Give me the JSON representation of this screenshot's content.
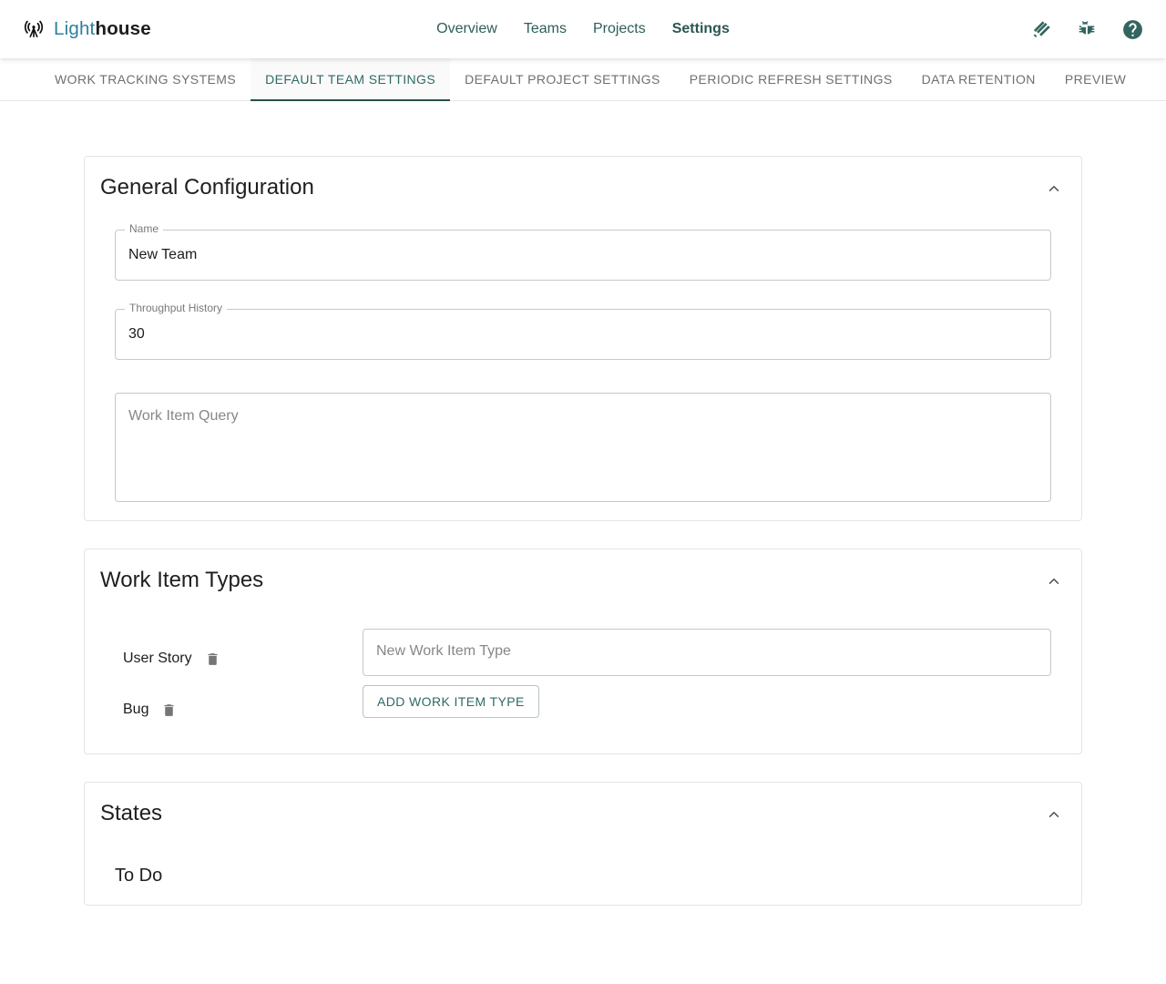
{
  "brand": {
    "name_light": "Light",
    "name_bold": "house",
    "icon": "broadcast-tower-icon"
  },
  "header": {
    "nav": [
      {
        "label": "Overview",
        "active": false
      },
      {
        "label": "Teams",
        "active": false
      },
      {
        "label": "Projects",
        "active": false
      },
      {
        "label": "Settings",
        "active": true
      }
    ],
    "actions": [
      {
        "icon": "contribute-hands-icon",
        "label": "Contribute"
      },
      {
        "icon": "bug-icon",
        "label": "Report a Bug"
      },
      {
        "icon": "help-circle-icon",
        "label": "Help"
      }
    ]
  },
  "tabs": [
    {
      "label": "WORK TRACKING SYSTEMS",
      "active": false
    },
    {
      "label": "DEFAULT TEAM SETTINGS",
      "active": true
    },
    {
      "label": "DEFAULT PROJECT SETTINGS",
      "active": false
    },
    {
      "label": "PERIODIC REFRESH SETTINGS",
      "active": false
    },
    {
      "label": "DATA RETENTION",
      "active": false
    },
    {
      "label": "PREVIEW",
      "active": false
    }
  ],
  "general_configuration": {
    "title": "General Configuration",
    "collapse_icon": "chevron-up-icon",
    "name_field": {
      "label": "Name",
      "value": "New Team"
    },
    "throughput_field": {
      "label": "Throughput History",
      "value": "30"
    },
    "query_field": {
      "placeholder": "Work Item Query",
      "value": ""
    }
  },
  "work_item_types": {
    "title": "Work Item Types",
    "collapse_icon": "chevron-up-icon",
    "items": [
      {
        "label": "User Story",
        "delete_icon": "trash-icon"
      },
      {
        "label": "Bug",
        "delete_icon": "trash-icon"
      }
    ],
    "new_type_placeholder": "New Work Item Type",
    "new_type_value": "",
    "add_button": "ADD WORK ITEM TYPE"
  },
  "states": {
    "title": "States",
    "collapse_icon": "chevron-up-icon",
    "groups": [
      {
        "label": "To Do"
      }
    ]
  },
  "colors": {
    "brand_light": "#2f7f9e",
    "brand_dark": "#1d1d1d",
    "accent_teal": "#2e5e59",
    "tab_active": "#2f6a64",
    "tab_indicator": "#2a4f4a",
    "muted_text": "#6f6f6f",
    "border": "#e4e4e4"
  }
}
